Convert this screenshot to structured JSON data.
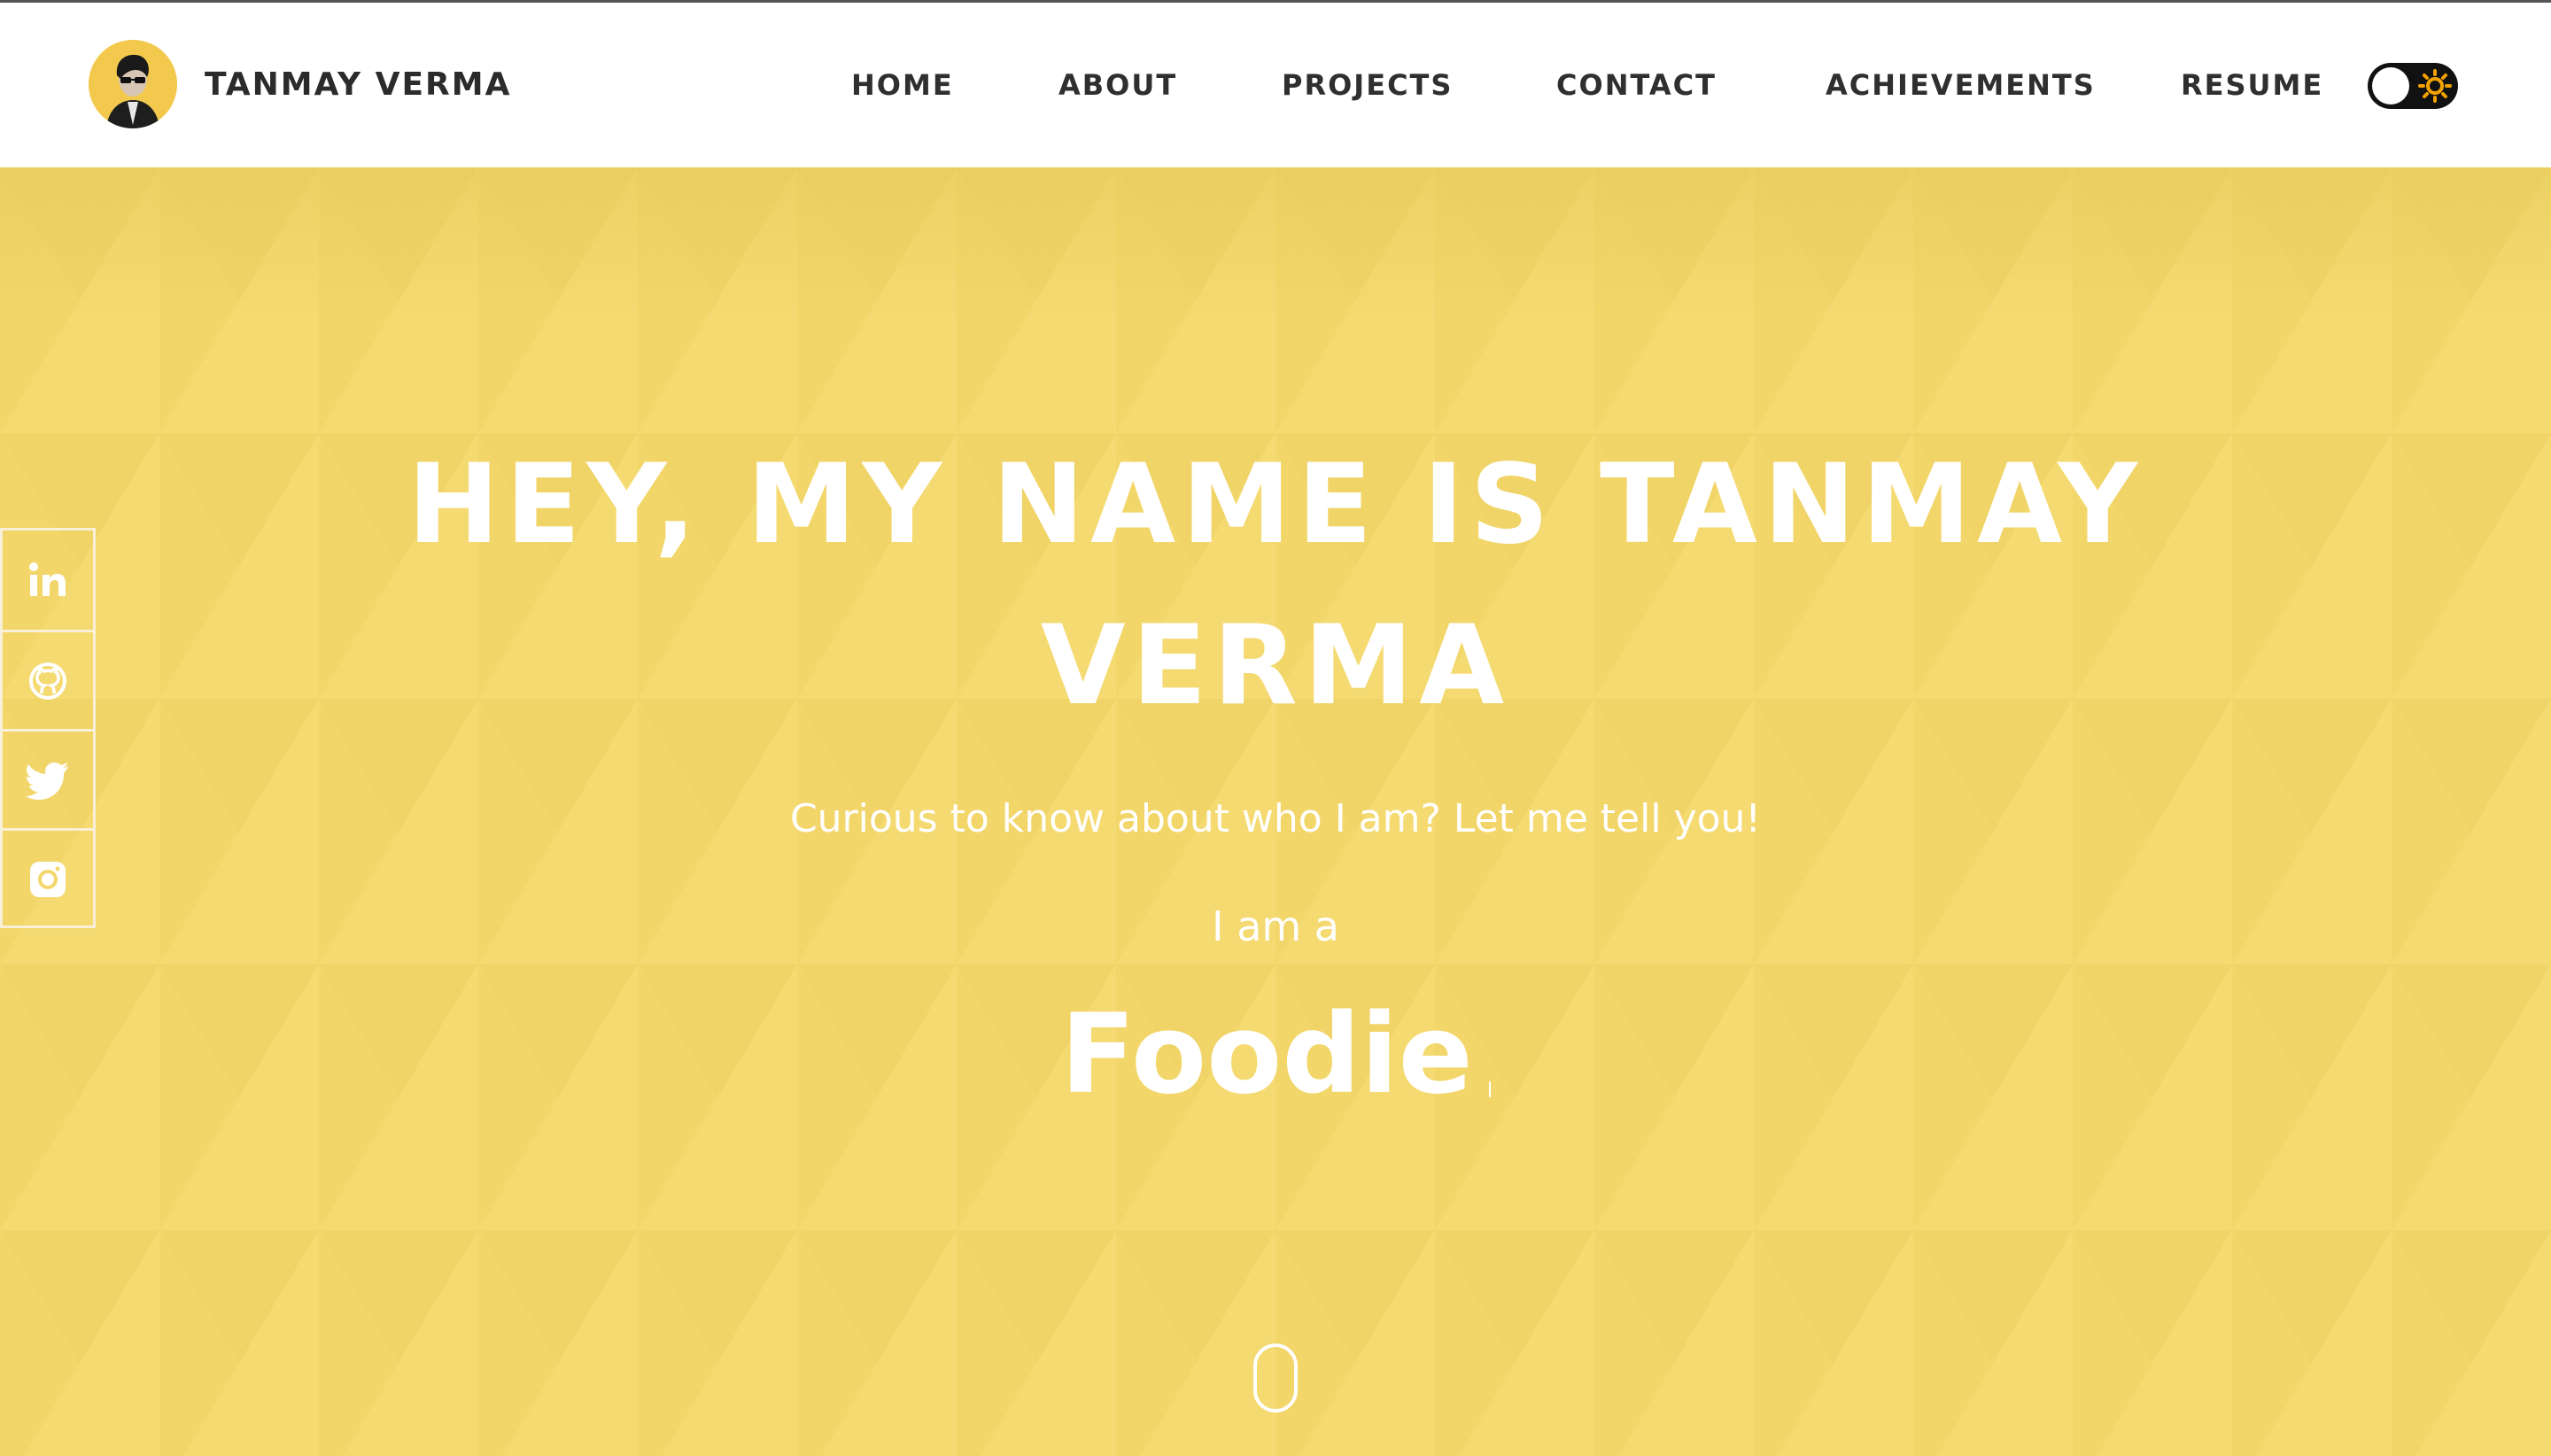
{
  "brand": {
    "name": "TANMAY VERMA",
    "avatar_icon": "profile-photo"
  },
  "nav": {
    "items": [
      {
        "label": "HOME"
      },
      {
        "label": "ABOUT"
      },
      {
        "label": "PROJECTS"
      },
      {
        "label": "CONTACT"
      },
      {
        "label": "ACHIEVEMENTS"
      },
      {
        "label": "RESUME"
      }
    ],
    "theme_toggle": {
      "state": "light",
      "icon": "sun-icon"
    }
  },
  "hero": {
    "title_line1": "HEY, MY NAME IS TANMAY",
    "title_line2": "VERMA",
    "subtitle": "Curious to know about who I am? Let me tell you!",
    "intro": "I am a",
    "role": "Foodie"
  },
  "social": [
    {
      "name": "linkedin",
      "icon": "linkedin-icon"
    },
    {
      "name": "github",
      "icon": "github-icon"
    },
    {
      "name": "twitter",
      "icon": "twitter-icon"
    },
    {
      "name": "instagram",
      "icon": "instagram-icon"
    }
  ],
  "colors": {
    "hero_bg": "#f3d76c",
    "header_bg": "#ffffff",
    "nav_text": "#2f2f2f",
    "accent": "#f2c94c",
    "toggle_bg": "#111111",
    "sun": "#f2a100"
  }
}
